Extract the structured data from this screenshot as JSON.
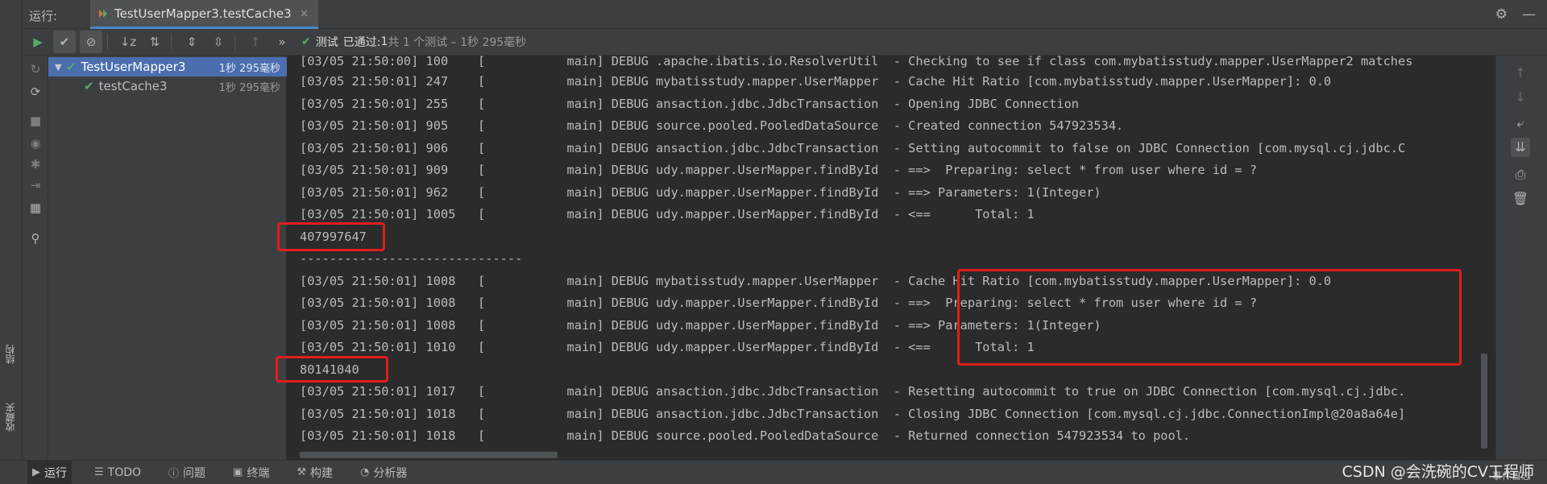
{
  "window": {
    "run_label": "运行:",
    "tab_title": "TestUserMapper3.testCache3",
    "tab_close": "×"
  },
  "edge": {
    "structure_label": "结构",
    "favorites_label": "收藏夹"
  },
  "toolbar": {
    "status_prefix": "测试",
    "status_passed": "已通过:",
    "status_count": "1",
    "status_detail": "共 1 个测试 – 1秒 295毫秒"
  },
  "tree": {
    "items": [
      {
        "label": "TestUserMapper3",
        "time": "1秒 295毫秒",
        "selected": true
      },
      {
        "label": "testCache3",
        "time": "1秒 295毫秒",
        "selected": false
      }
    ]
  },
  "console": {
    "lines": [
      "[03/05 21:50:00] 100    [           main] DEBUG .apache.ibatis.io.ResolverUtil  - Checking to see if class com.mybatisstudy.mapper.UserMapper2 matches",
      "[03/05 21:50:01] 247    [           main] DEBUG mybatisstudy.mapper.UserMapper  - Cache Hit Ratio [com.mybatisstudy.mapper.UserMapper]: 0.0",
      "[03/05 21:50:01] 255    [           main] DEBUG ansaction.jdbc.JdbcTransaction  - Opening JDBC Connection",
      "[03/05 21:50:01] 905    [           main] DEBUG source.pooled.PooledDataSource  - Created connection 547923534.",
      "[03/05 21:50:01] 906    [           main] DEBUG ansaction.jdbc.JdbcTransaction  - Setting autocommit to false on JDBC Connection [com.mysql.cj.jdbc.C",
      "[03/05 21:50:01] 909    [           main] DEBUG udy.mapper.UserMapper.findById  - ==>  Preparing: select * from user where id = ?",
      "[03/05 21:50:01] 962    [           main] DEBUG udy.mapper.UserMapper.findById  - ==> Parameters: 1(Integer)",
      "[03/05 21:50:01] 1005   [           main] DEBUG udy.mapper.UserMapper.findById  - <==      Total: 1",
      "407997647",
      "------------------------------",
      "[03/05 21:50:01] 1008   [           main] DEBUG mybatisstudy.mapper.UserMapper  - Cache Hit Ratio [com.mybatisstudy.mapper.UserMapper]: 0.0",
      "[03/05 21:50:01] 1008   [           main] DEBUG udy.mapper.UserMapper.findById  - ==>  Preparing: select * from user where id = ?",
      "[03/05 21:50:01] 1008   [           main] DEBUG udy.mapper.UserMapper.findById  - ==> Parameters: 1(Integer)",
      "[03/05 21:50:01] 1010   [           main] DEBUG udy.mapper.UserMapper.findById  - <==      Total: 1",
      "80141040",
      "[03/05 21:50:01] 1017   [           main] DEBUG ansaction.jdbc.JdbcTransaction  - Resetting autocommit to true on JDBC Connection [com.mysql.cj.jdbc.",
      "[03/05 21:50:01] 1018   [           main] DEBUG ansaction.jdbc.JdbcTransaction  - Closing JDBC Connection [com.mysql.cj.jdbc.ConnectionImpl@20a8a64e]",
      "[03/05 21:50:01] 1018   [           main] DEBUG source.pooled.PooledDataSource  - Returned connection 547923534 to pool."
    ]
  },
  "bottombar": {
    "items": [
      "运行",
      "TODO",
      "问题",
      "终端",
      "构建",
      "分析器"
    ],
    "event_log": "事件日志",
    "watermark": "CSDN @会洗碗的CV工程师"
  },
  "colors": {
    "accent": "#4b6eaf",
    "pass": "#59a869",
    "highlight": "#e01e1e"
  }
}
